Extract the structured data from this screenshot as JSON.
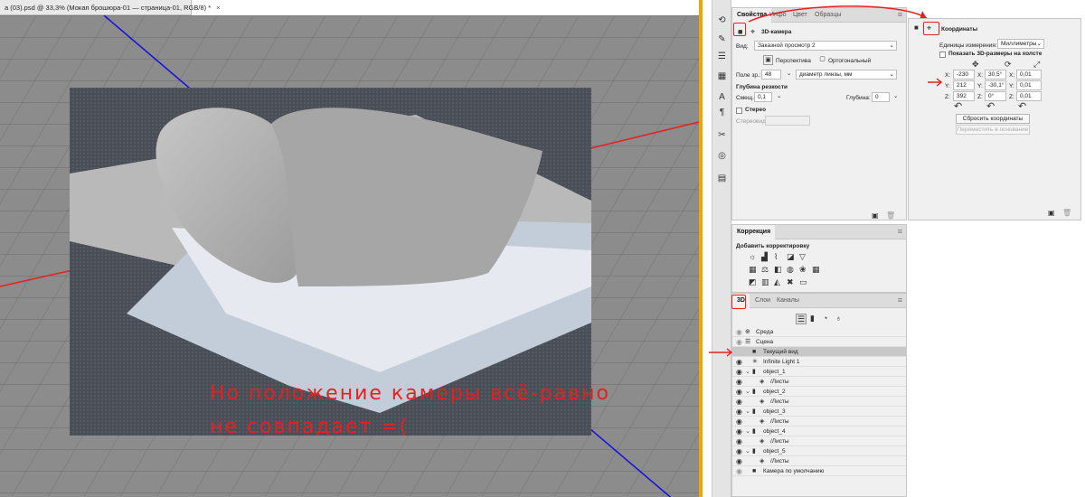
{
  "document": {
    "tab_title": "а (03).psd @ 33,3% (Мокап брошюра-01 — страница-01, RGB/8) *",
    "close": "×"
  },
  "annotation": {
    "line1": "Но положение камеры всё-равно",
    "line2": "не совпадает =("
  },
  "properties": {
    "tabs": [
      "Свойства",
      "Инфо",
      "Цвет",
      "Образцы"
    ],
    "camera_title": "3D-камера",
    "view_label": "Вид:",
    "view_value": "Заказной просмотр 2",
    "perspective": "Перспектива",
    "orthographic": "Ортогональный",
    "fov_label": "Поле зр.:",
    "fov_value": "48",
    "lens_value": "диаметр линзы, мм",
    "dof_title": "Глубина резкости",
    "offset_label": "Смещ.:",
    "offset_value": "0,1",
    "depth_label": "Глубина:",
    "depth_value": "0",
    "stereo": "Стерео",
    "stereo_view": "Стереовид:"
  },
  "coordinates": {
    "title": "Координаты",
    "units_label": "Единицы измерения:",
    "units_value": "Миллиметры",
    "show3d": "Показать 3D-размеры на холсте",
    "rows": [
      {
        "a": "X:",
        "v1": "-230",
        "b": "X:",
        "v2": "30,5°",
        "c": "X:",
        "v3": "0,01"
      },
      {
        "a": "Y:",
        "v1": "212",
        "b": "Y:",
        "v2": "-30,1°",
        "c": "Y:",
        "v3": "0,01"
      },
      {
        "a": "Z:",
        "v1": "392",
        "b": "Z:",
        "v2": "0°",
        "c": "Z:",
        "v3": "0,01"
      }
    ],
    "reset": "Сбросить координаты",
    "move_to_ground": "Переместить в основание"
  },
  "adjustments": {
    "tab": "Коррекция",
    "title": "Добавить корректировку"
  },
  "panel3d": {
    "tabs": [
      "3D",
      "Слои",
      "Каналы"
    ],
    "rows": [
      {
        "label": "Среда",
        "icon": "globe-icon"
      },
      {
        "label": "Сцена",
        "icon": "scene-icon"
      },
      {
        "label": "Текущий вид",
        "icon": "camera-icon"
      },
      {
        "label": "Infinite Light 1",
        "icon": "light-icon"
      },
      {
        "label": "object_1",
        "icon": "object-icon"
      },
      {
        "label": "/Листы",
        "icon": "material-icon"
      },
      {
        "label": "object_2",
        "icon": "object-icon"
      },
      {
        "label": "/Листы",
        "icon": "material-icon"
      },
      {
        "label": "object_3",
        "icon": "object-icon"
      },
      {
        "label": "/Листы",
        "icon": "material-icon"
      },
      {
        "label": "object_4",
        "icon": "object-icon"
      },
      {
        "label": "/Листы",
        "icon": "material-icon"
      },
      {
        "label": "object_5",
        "icon": "object-icon"
      },
      {
        "label": "/Листы",
        "icon": "material-icon"
      },
      {
        "label": "Камера по умолчанию",
        "icon": "camera-icon"
      }
    ]
  },
  "colors": {
    "accent_red": "#e52020",
    "axis_blue": "#1010e0",
    "scroll_orange": "#f0a500"
  }
}
